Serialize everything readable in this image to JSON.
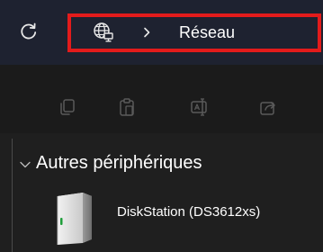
{
  "address_bar": {
    "location_icon": "network-globe-icon",
    "separator_icon": "chevron-right-icon",
    "current_location": "Réseau"
  },
  "toolbar": {
    "refresh_icon": "refresh-icon",
    "buttons": [
      {
        "icon": "copy-icon"
      },
      {
        "icon": "paste-icon"
      },
      {
        "icon": "rename-icon"
      },
      {
        "icon": "share-icon"
      }
    ]
  },
  "content": {
    "group_label": "Autres périphériques",
    "devices": [
      {
        "label": "DiskStation (DS3612xs)",
        "icon": "server-icon"
      }
    ]
  },
  "colors": {
    "highlight_border": "#e31b1b",
    "titlebar_bg": "#1e2230",
    "window_bg": "#1c1c1c"
  }
}
